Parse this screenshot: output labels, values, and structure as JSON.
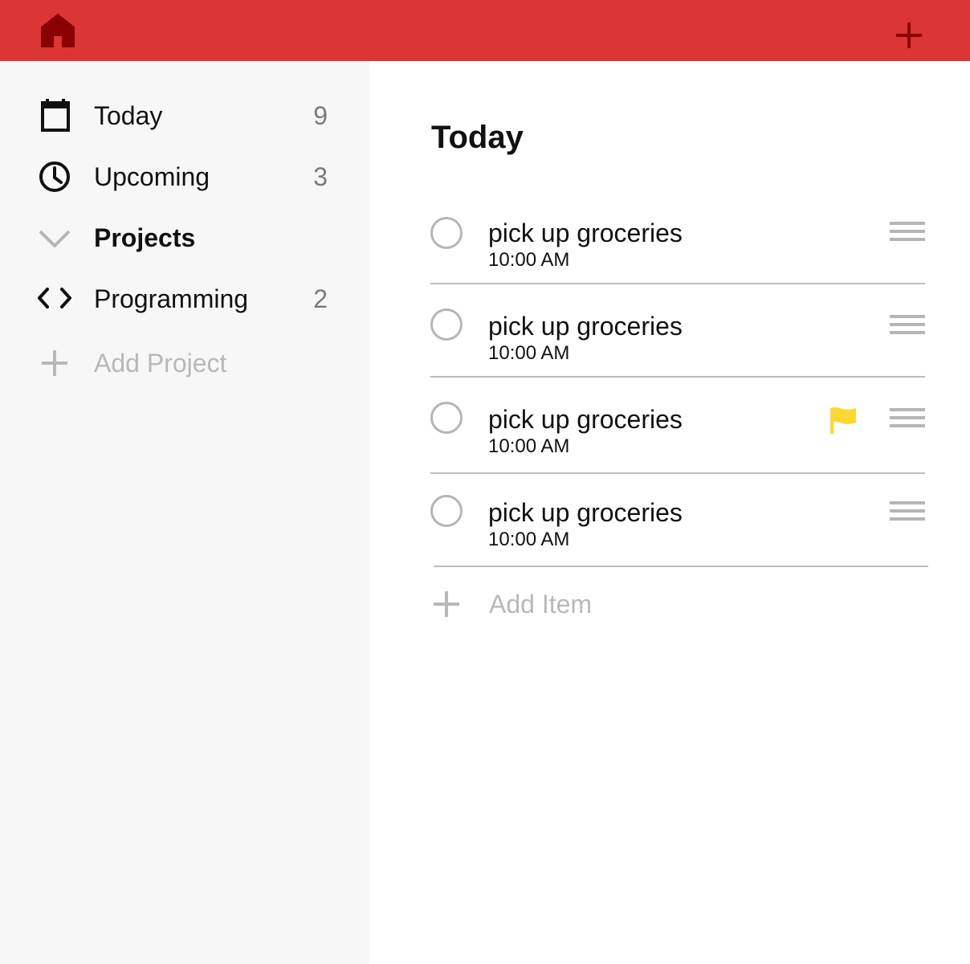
{
  "colors": {
    "topbar": "#dc3535",
    "icon_dark_red": "#8b0000",
    "flag": "#fdd835",
    "muted": "#b8b8b8"
  },
  "topbar": {
    "home_icon": "home-icon",
    "add_icon": "plus-icon"
  },
  "sidebar": {
    "items": [
      {
        "label": "Today",
        "count": "9",
        "icon": "calendar-icon"
      },
      {
        "label": "Upcoming",
        "count": "3",
        "icon": "clock-icon"
      },
      {
        "label": "Projects",
        "icon": "chevron-down-icon"
      },
      {
        "label": "Programming",
        "count": "2",
        "icon": "code-icon"
      },
      {
        "label": "Add Project",
        "icon": "plus-icon"
      }
    ]
  },
  "main": {
    "title": "Today",
    "tasks": [
      {
        "title": "pick up groceries",
        "time": "10:00 AM",
        "flagged": false
      },
      {
        "title": "pick up groceries",
        "time": "10:00 AM",
        "flagged": false
      },
      {
        "title": "pick up groceries",
        "time": "10:00 AM",
        "flagged": true
      },
      {
        "title": "pick up groceries",
        "time": "10:00 AM",
        "flagged": false
      }
    ],
    "add_item_label": "Add Item"
  }
}
